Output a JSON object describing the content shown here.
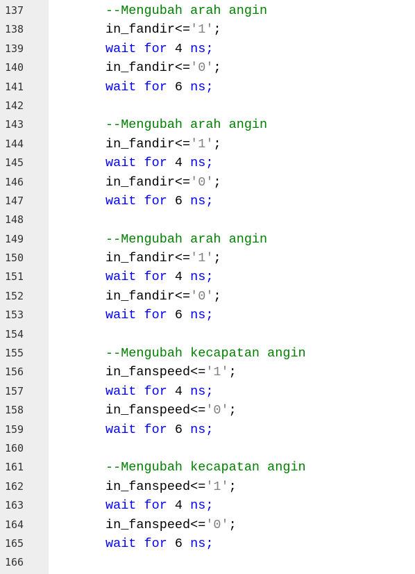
{
  "editor": {
    "lines": [
      {
        "num": "137",
        "tokens": [
          {
            "t": "--Mengubah arah angin",
            "k": "comment"
          }
        ]
      },
      {
        "num": "138",
        "tokens": [
          {
            "t": "in_fandir<=",
            "k": "plain"
          },
          {
            "t": "'1'",
            "k": "string"
          },
          {
            "t": ";",
            "k": "plain"
          }
        ]
      },
      {
        "num": "139",
        "tokens": [
          {
            "t": "wait for",
            "k": "keyword"
          },
          {
            "t": " 4 ",
            "k": "plain"
          },
          {
            "t": "ns;",
            "k": "keyword"
          }
        ]
      },
      {
        "num": "140",
        "tokens": [
          {
            "t": "in_fandir<=",
            "k": "plain"
          },
          {
            "t": "'0'",
            "k": "string"
          },
          {
            "t": ";",
            "k": "plain"
          }
        ]
      },
      {
        "num": "141",
        "tokens": [
          {
            "t": "wait for",
            "k": "keyword"
          },
          {
            "t": " 6 ",
            "k": "plain"
          },
          {
            "t": "ns;",
            "k": "keyword"
          }
        ]
      },
      {
        "num": "142",
        "tokens": []
      },
      {
        "num": "143",
        "tokens": [
          {
            "t": "--Mengubah arah angin",
            "k": "comment"
          }
        ]
      },
      {
        "num": "144",
        "tokens": [
          {
            "t": "in_fandir<=",
            "k": "plain"
          },
          {
            "t": "'1'",
            "k": "string"
          },
          {
            "t": ";",
            "k": "plain"
          }
        ]
      },
      {
        "num": "145",
        "tokens": [
          {
            "t": "wait for",
            "k": "keyword"
          },
          {
            "t": " 4 ",
            "k": "plain"
          },
          {
            "t": "ns;",
            "k": "keyword"
          }
        ]
      },
      {
        "num": "146",
        "tokens": [
          {
            "t": "in_fandir<=",
            "k": "plain"
          },
          {
            "t": "'0'",
            "k": "string"
          },
          {
            "t": ";",
            "k": "plain"
          }
        ]
      },
      {
        "num": "147",
        "tokens": [
          {
            "t": "wait for",
            "k": "keyword"
          },
          {
            "t": " 6 ",
            "k": "plain"
          },
          {
            "t": "ns;",
            "k": "keyword"
          }
        ]
      },
      {
        "num": "148",
        "tokens": []
      },
      {
        "num": "149",
        "tokens": [
          {
            "t": "--Mengubah arah angin",
            "k": "comment"
          }
        ]
      },
      {
        "num": "150",
        "tokens": [
          {
            "t": "in_fandir<=",
            "k": "plain"
          },
          {
            "t": "'1'",
            "k": "string"
          },
          {
            "t": ";",
            "k": "plain"
          }
        ]
      },
      {
        "num": "151",
        "tokens": [
          {
            "t": "wait for",
            "k": "keyword"
          },
          {
            "t": " 4 ",
            "k": "plain"
          },
          {
            "t": "ns;",
            "k": "keyword"
          }
        ]
      },
      {
        "num": "152",
        "tokens": [
          {
            "t": "in_fandir<=",
            "k": "plain"
          },
          {
            "t": "'0'",
            "k": "string"
          },
          {
            "t": ";",
            "k": "plain"
          }
        ]
      },
      {
        "num": "153",
        "tokens": [
          {
            "t": "wait for",
            "k": "keyword"
          },
          {
            "t": " 6 ",
            "k": "plain"
          },
          {
            "t": "ns;",
            "k": "keyword"
          }
        ]
      },
      {
        "num": "154",
        "tokens": []
      },
      {
        "num": "155",
        "tokens": [
          {
            "t": "--Mengubah kecapatan angin",
            "k": "comment"
          }
        ]
      },
      {
        "num": "156",
        "tokens": [
          {
            "t": "in_fanspeed<=",
            "k": "plain"
          },
          {
            "t": "'1'",
            "k": "string"
          },
          {
            "t": ";",
            "k": "plain"
          }
        ]
      },
      {
        "num": "157",
        "tokens": [
          {
            "t": "wait for",
            "k": "keyword"
          },
          {
            "t": " 4 ",
            "k": "plain"
          },
          {
            "t": "ns;",
            "k": "keyword"
          }
        ]
      },
      {
        "num": "158",
        "tokens": [
          {
            "t": "in_fanspeed<=",
            "k": "plain"
          },
          {
            "t": "'0'",
            "k": "string"
          },
          {
            "t": ";",
            "k": "plain"
          }
        ]
      },
      {
        "num": "159",
        "tokens": [
          {
            "t": "wait for",
            "k": "keyword"
          },
          {
            "t": " 6 ",
            "k": "plain"
          },
          {
            "t": "ns;",
            "k": "keyword"
          }
        ]
      },
      {
        "num": "160",
        "tokens": []
      },
      {
        "num": "161",
        "tokens": [
          {
            "t": "--Mengubah kecapatan angin",
            "k": "comment"
          }
        ]
      },
      {
        "num": "162",
        "tokens": [
          {
            "t": "in_fanspeed<=",
            "k": "plain"
          },
          {
            "t": "'1'",
            "k": "string"
          },
          {
            "t": ";",
            "k": "plain"
          }
        ]
      },
      {
        "num": "163",
        "tokens": [
          {
            "t": "wait for",
            "k": "keyword"
          },
          {
            "t": " 4 ",
            "k": "plain"
          },
          {
            "t": "ns;",
            "k": "keyword"
          }
        ]
      },
      {
        "num": "164",
        "tokens": [
          {
            "t": "in_fanspeed<=",
            "k": "plain"
          },
          {
            "t": "'0'",
            "k": "string"
          },
          {
            "t": ";",
            "k": "plain"
          }
        ]
      },
      {
        "num": "165",
        "tokens": [
          {
            "t": "wait for",
            "k": "keyword"
          },
          {
            "t": " 6 ",
            "k": "plain"
          },
          {
            "t": "ns;",
            "k": "keyword"
          }
        ]
      },
      {
        "num": "166",
        "tokens": []
      }
    ]
  },
  "colors": {
    "comment": "#008000",
    "keyword": "#0000ff",
    "plain": "#000000",
    "string": "#808080",
    "gutter_bg": "#eeeeee",
    "editor_bg": "#ffffff"
  }
}
